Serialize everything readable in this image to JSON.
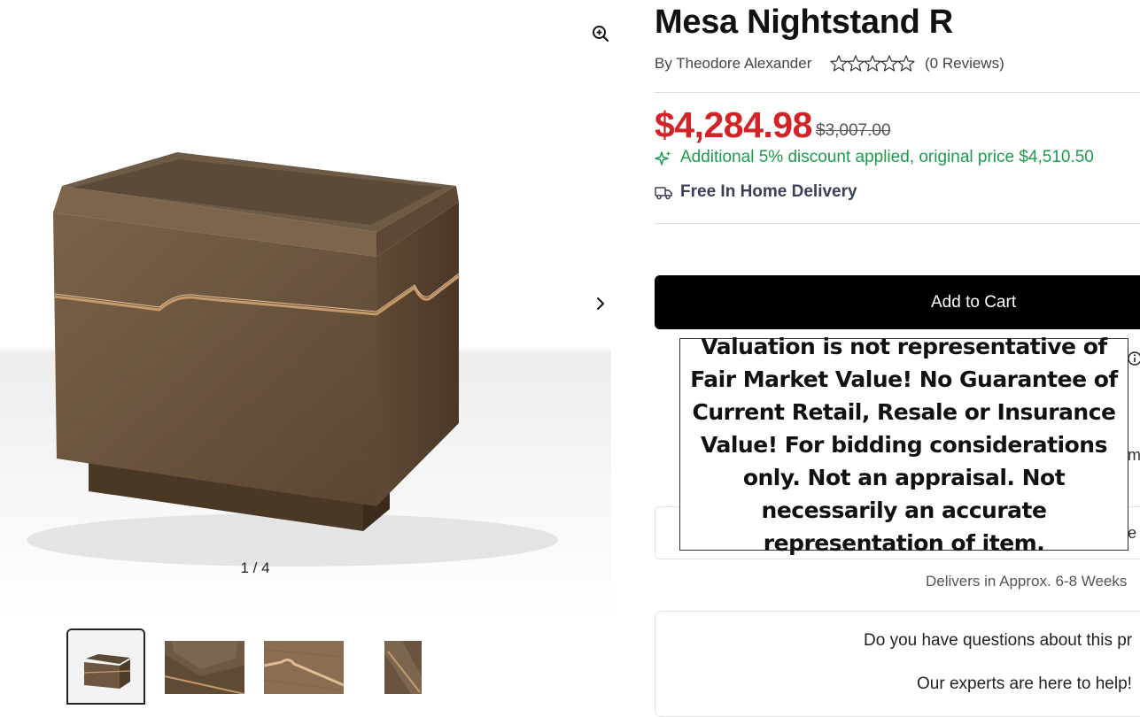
{
  "product": {
    "title": "Mesa Nightstand R",
    "byline": "By Theodore Alexander",
    "rating_stars": 0,
    "reviews": "(0 Reviews)",
    "price": "$4,284.98",
    "old_price": "$3,007.00",
    "discount_note": "Additional 5% discount applied, original price $4,510.50",
    "delivery": "Free In Home Delivery",
    "add_to_cart_label": "Add to Cart",
    "eta": "Delivers in Approx. 6-8 Weeks"
  },
  "gallery": {
    "counter": "1 / 4",
    "zoom_icon": "zoom-in-icon",
    "next_icon": "chevron-right-icon",
    "thumbnail_count": 4
  },
  "disclaimer": "Valuation is not representative of Fair Market Value! No Guarantee of Current Retail, Resale or Insurance Value! For bidding considerations only. Not an appraisal. Not necessarily an accurate representation of item.",
  "partial": {
    "right_letter_1": "m",
    "right_letter_2": "e"
  },
  "help": {
    "question": "Do you have questions about this pr",
    "answer": "Our experts are here to help!"
  },
  "colors": {
    "sale_price": "#d42326",
    "discount_green": "#1e9a4c",
    "delivery_navy": "#3a3f58",
    "button": "#000000"
  }
}
